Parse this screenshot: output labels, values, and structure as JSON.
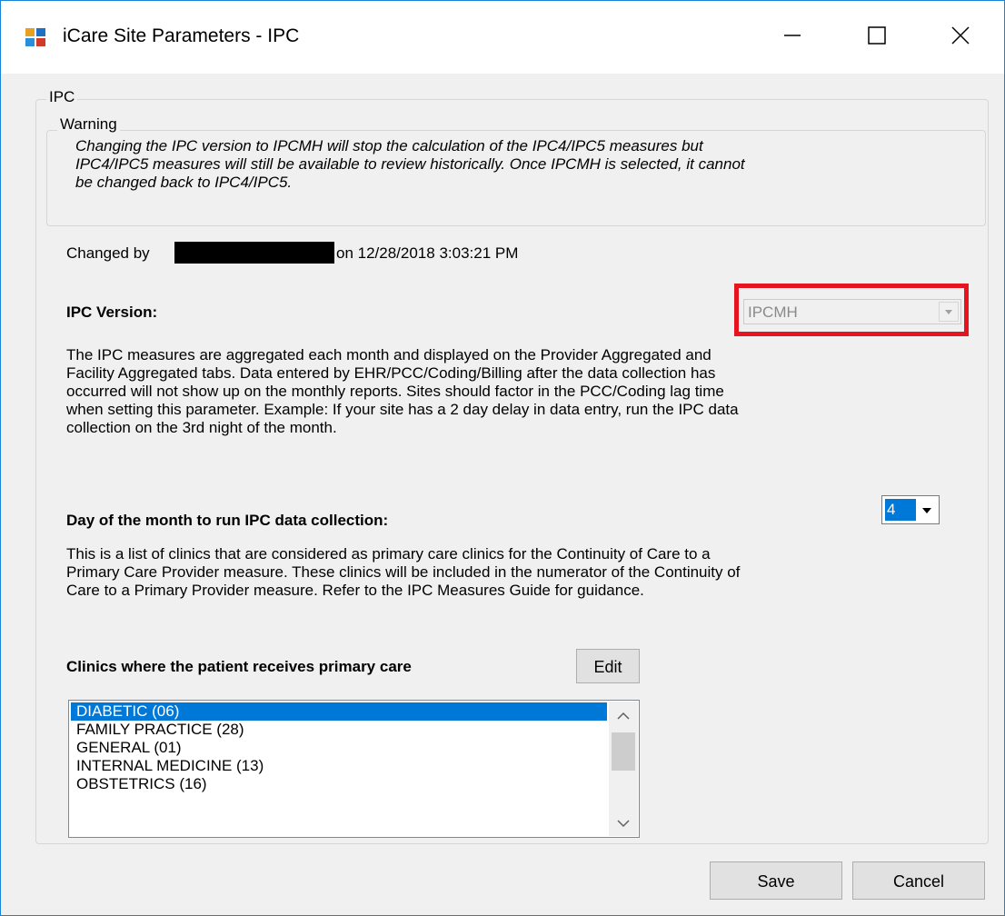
{
  "window": {
    "title": "iCare Site Parameters - IPC",
    "controls": [
      "minimize-icon",
      "maximize-icon",
      "close-icon"
    ]
  },
  "group": {
    "legend": "IPC"
  },
  "warning": {
    "legend": "Warning",
    "line1": "Changing the IPC version to IPCMH will stop the calculation of the IPC4/IPC5 measures but",
    "line2": "IPC4/IPC5 measures will still be available to review historically.  Once IPCMH is selected, it cannot",
    "line3": "be changed back to IPC4/IPC5."
  },
  "changed": {
    "prefix": "Changed by",
    "suffix": "on 12/28/2018 3:03:21 PM"
  },
  "ipc_version": {
    "label": "IPC Version:",
    "value": "IPCMH",
    "disabled": true
  },
  "aggregation_desc": {
    "line1": "The IPC measures are aggregated each month and displayed on the Provider Aggregated and",
    "line2": "Facility Aggregated tabs. Data entered by EHR/PCC/Coding/Billing after the data collection has",
    "line3": "occurred will not show up on the monthly reports.  Sites should factor in the PCC/Coding lag time",
    "line4": "when setting this parameter.  Example: If your site has a 2 day delay in data entry, run the IPC data",
    "line5": "collection on the 3rd night of the month."
  },
  "day_of_month": {
    "label": "Day of the month to run IPC data collection:",
    "value": "4"
  },
  "clinics_desc": {
    "line1": "This is a list of clinics that are considered as primary care clinics for the Continuity of Care to a",
    "line2": "Primary Care Provider measure.  These clinics will be included in the numerator of the Continuity of",
    "line3": "Care to a Primary Provider measure.  Refer to the IPC Measures Guide for guidance."
  },
  "clinics": {
    "label": "Clinics where the patient receives primary care",
    "edit_label": "Edit",
    "items": [
      "DIABETIC (06)",
      "FAMILY PRACTICE (28)",
      "GENERAL (01)",
      "INTERNAL MEDICINE (13)",
      "OBSTETRICS (16)"
    ],
    "selected_index": 0
  },
  "buttons": {
    "save": "Save",
    "cancel": "Cancel"
  },
  "colors": {
    "highlight": "#e5141f",
    "selection": "#0078d7",
    "window_border": "#1883d7"
  }
}
